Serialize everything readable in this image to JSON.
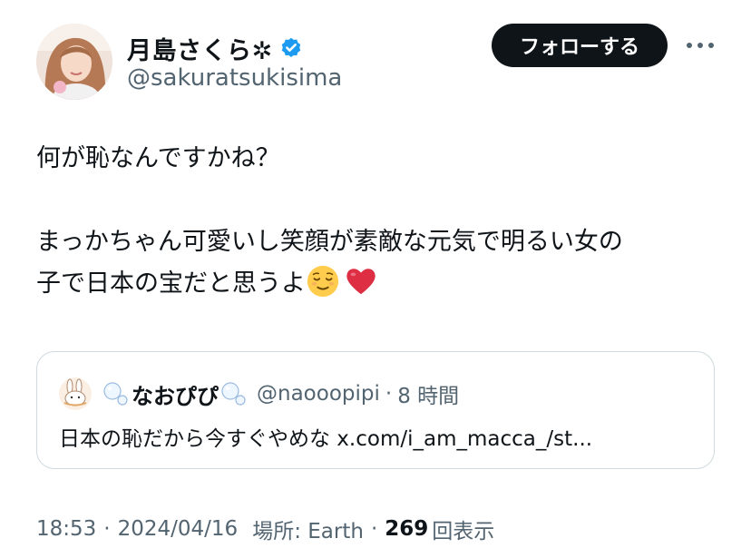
{
  "author": {
    "display_name": "月島さくら✲",
    "handle": "@sakuratsukisima",
    "verified_icon": "verified-badge-icon",
    "verified_color": "#1d9bf0"
  },
  "actions": {
    "follow_label": "フォローする",
    "more_icon": "more-horizontal-icon"
  },
  "tweet": {
    "line1": "何が恥なんですかね？",
    "line2": "まっかちゃん可愛いし笑顔が素敵な元気で明るい女の",
    "line3": "子で日本の宝だと思うよ",
    "emoji1": "relieved-face-emoji",
    "emoji2": "red-heart-emoji"
  },
  "quote": {
    "display_name": "なおぴぴ",
    "handle": "@naooopipi",
    "dot": "·",
    "time": "8 時間",
    "text": "日本の恥だから今すぐやめな x.com/i_am_macca_/st...",
    "avatar_icon": "bunny-avatar-icon",
    "bubble_icon": "bubbles-icon"
  },
  "meta": {
    "time": "18:53",
    "sep": "·",
    "date": "2024/04/16",
    "location": "場所: Earth",
    "views": "269",
    "views_label": "回表示"
  }
}
